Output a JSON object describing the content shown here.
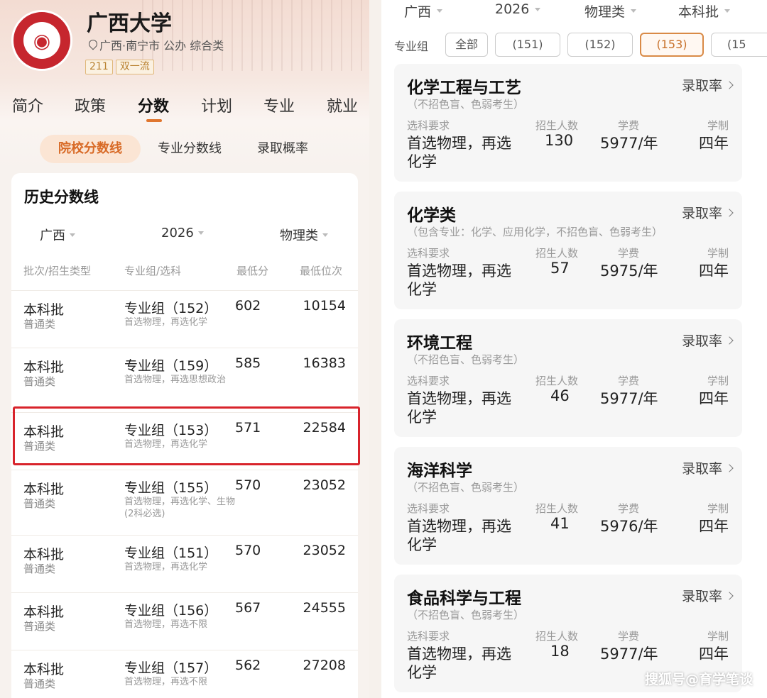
{
  "university": {
    "name": "广西大学",
    "location": "广西·南宁市 公办 综合类",
    "tags": [
      "211",
      "双一流"
    ]
  },
  "tabs": [
    "简介",
    "政策",
    "分数",
    "计划",
    "专业",
    "就业"
  ],
  "subtabs": [
    "院校分数线",
    "专业分数线",
    "录取概率"
  ],
  "history": {
    "title": "历史分数线",
    "filters": [
      "广西",
      "2026",
      "物理类"
    ],
    "columns": [
      "批次/招生类型",
      "专业组/选科",
      "最低分",
      "最低位次"
    ],
    "rows": [
      {
        "batch": "本科批",
        "type": "普通类",
        "group": "专业组（152）",
        "req": "首选物理，再选化学",
        "min": "602",
        "rank": "10154"
      },
      {
        "batch": "本科批",
        "type": "普通类",
        "group": "专业组（159）",
        "req": "首选物理，再选思想政治",
        "min": "585",
        "rank": "16383"
      },
      {
        "batch": "本科批",
        "type": "普通类",
        "group": "专业组（153）",
        "req": "首选物理，再选化学",
        "min": "571",
        "rank": "22584"
      },
      {
        "batch": "本科批",
        "type": "普通类",
        "group": "专业组（155）",
        "req": "首选物理，再选化学、生物(2科必选)",
        "min": "570",
        "rank": "23052"
      },
      {
        "batch": "本科批",
        "type": "普通类",
        "group": "专业组（151）",
        "req": "首选物理，再选化学",
        "min": "570",
        "rank": "23052"
      },
      {
        "batch": "本科批",
        "type": "普通类",
        "group": "专业组（156）",
        "req": "首选物理，再选不限",
        "min": "567",
        "rank": "24555"
      },
      {
        "batch": "本科批",
        "type": "普通类",
        "group": "专业组（157）",
        "req": "首选物理，再选不限",
        "min": "562",
        "rank": "27208"
      }
    ]
  },
  "right": {
    "filters": [
      "广西",
      "2026",
      "物理类",
      "本科批"
    ],
    "group_label": "专业组",
    "chips": [
      "全部",
      "(151)",
      "(152)",
      "(153)",
      "(15"
    ],
    "labels": {
      "req": "选科要求",
      "count": "招生人数",
      "fee": "学费",
      "years": "学制"
    },
    "rate_label": "录取率",
    "majors": [
      {
        "name": "化学工程与工艺",
        "note": "（不招色盲、色弱考生）",
        "req1": "首选物理，再选",
        "req2": "化学",
        "count": "130",
        "fee": "5977/年",
        "years": "四年"
      },
      {
        "name": "化学类",
        "note": "（包含专业：化学、应用化学，不招色盲、色弱考生）",
        "req1": "首选物理，再选",
        "req2": "化学",
        "count": "57",
        "fee": "5975/年",
        "years": "四年"
      },
      {
        "name": "环境工程",
        "note": "（不招色盲、色弱考生）",
        "req1": "首选物理，再选",
        "req2": "化学",
        "count": "46",
        "fee": "5977/年",
        "years": "四年"
      },
      {
        "name": "海洋科学",
        "note": "（不招色盲、色弱考生）",
        "req1": "首选物理，再选",
        "req2": "化学",
        "count": "41",
        "fee": "5976/年",
        "years": "四年"
      },
      {
        "name": "食品科学与工程",
        "note": "（不招色盲、色弱考生）",
        "req1": "首选物理，再选",
        "req2": "化学",
        "count": "18",
        "fee": "5977/年",
        "years": "四年"
      }
    ]
  },
  "watermark": "搜狐号@育学笔谈"
}
